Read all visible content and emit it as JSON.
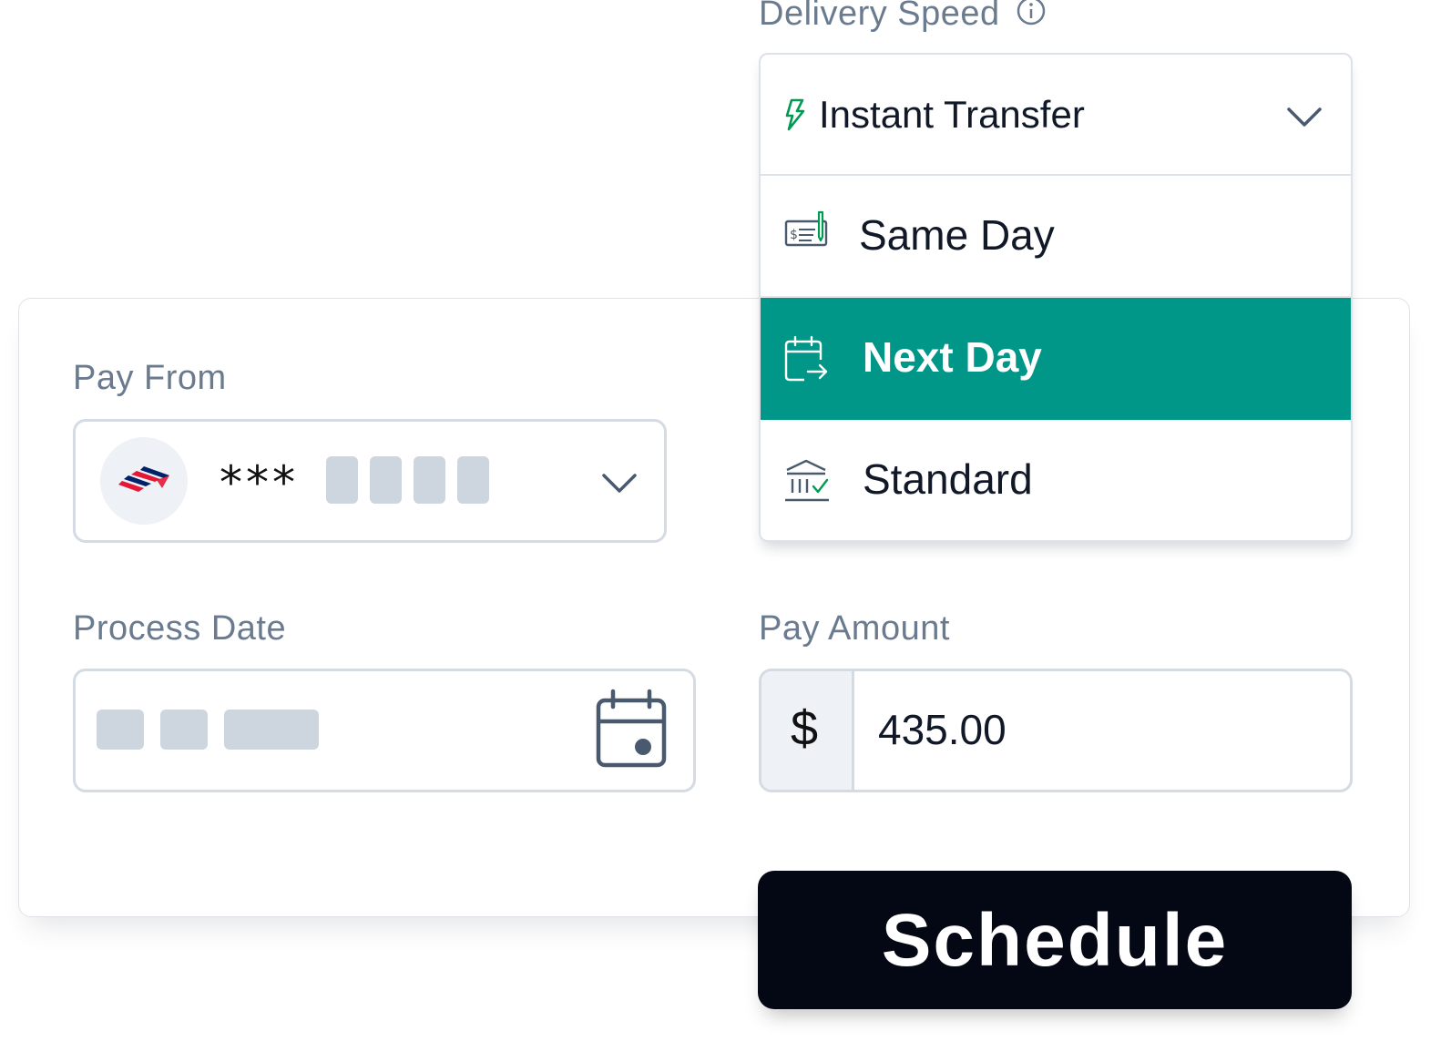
{
  "delivery_speed": {
    "label": "Delivery Speed",
    "info_icon": "info-icon",
    "selected": "Instant Transfer",
    "selected_icon": "lightning-icon",
    "options": [
      {
        "label": "Same Day",
        "icon": "check-icon"
      },
      {
        "label": "Next Day",
        "icon": "calendar-arrow-icon",
        "highlighted": true
      },
      {
        "label": "Standard",
        "icon": "bank-icon"
      }
    ],
    "highlight_color": "#009688"
  },
  "pay_from": {
    "label": "Pay From",
    "bank_icon": "bank-of-america-logo",
    "masked_prefix": "***"
  },
  "process_date": {
    "label": "Process Date",
    "icon": "calendar-icon"
  },
  "pay_amount": {
    "label": "Pay Amount",
    "currency_symbol": "$",
    "value": "435.00"
  },
  "actions": {
    "schedule_label": "Schedule"
  }
}
